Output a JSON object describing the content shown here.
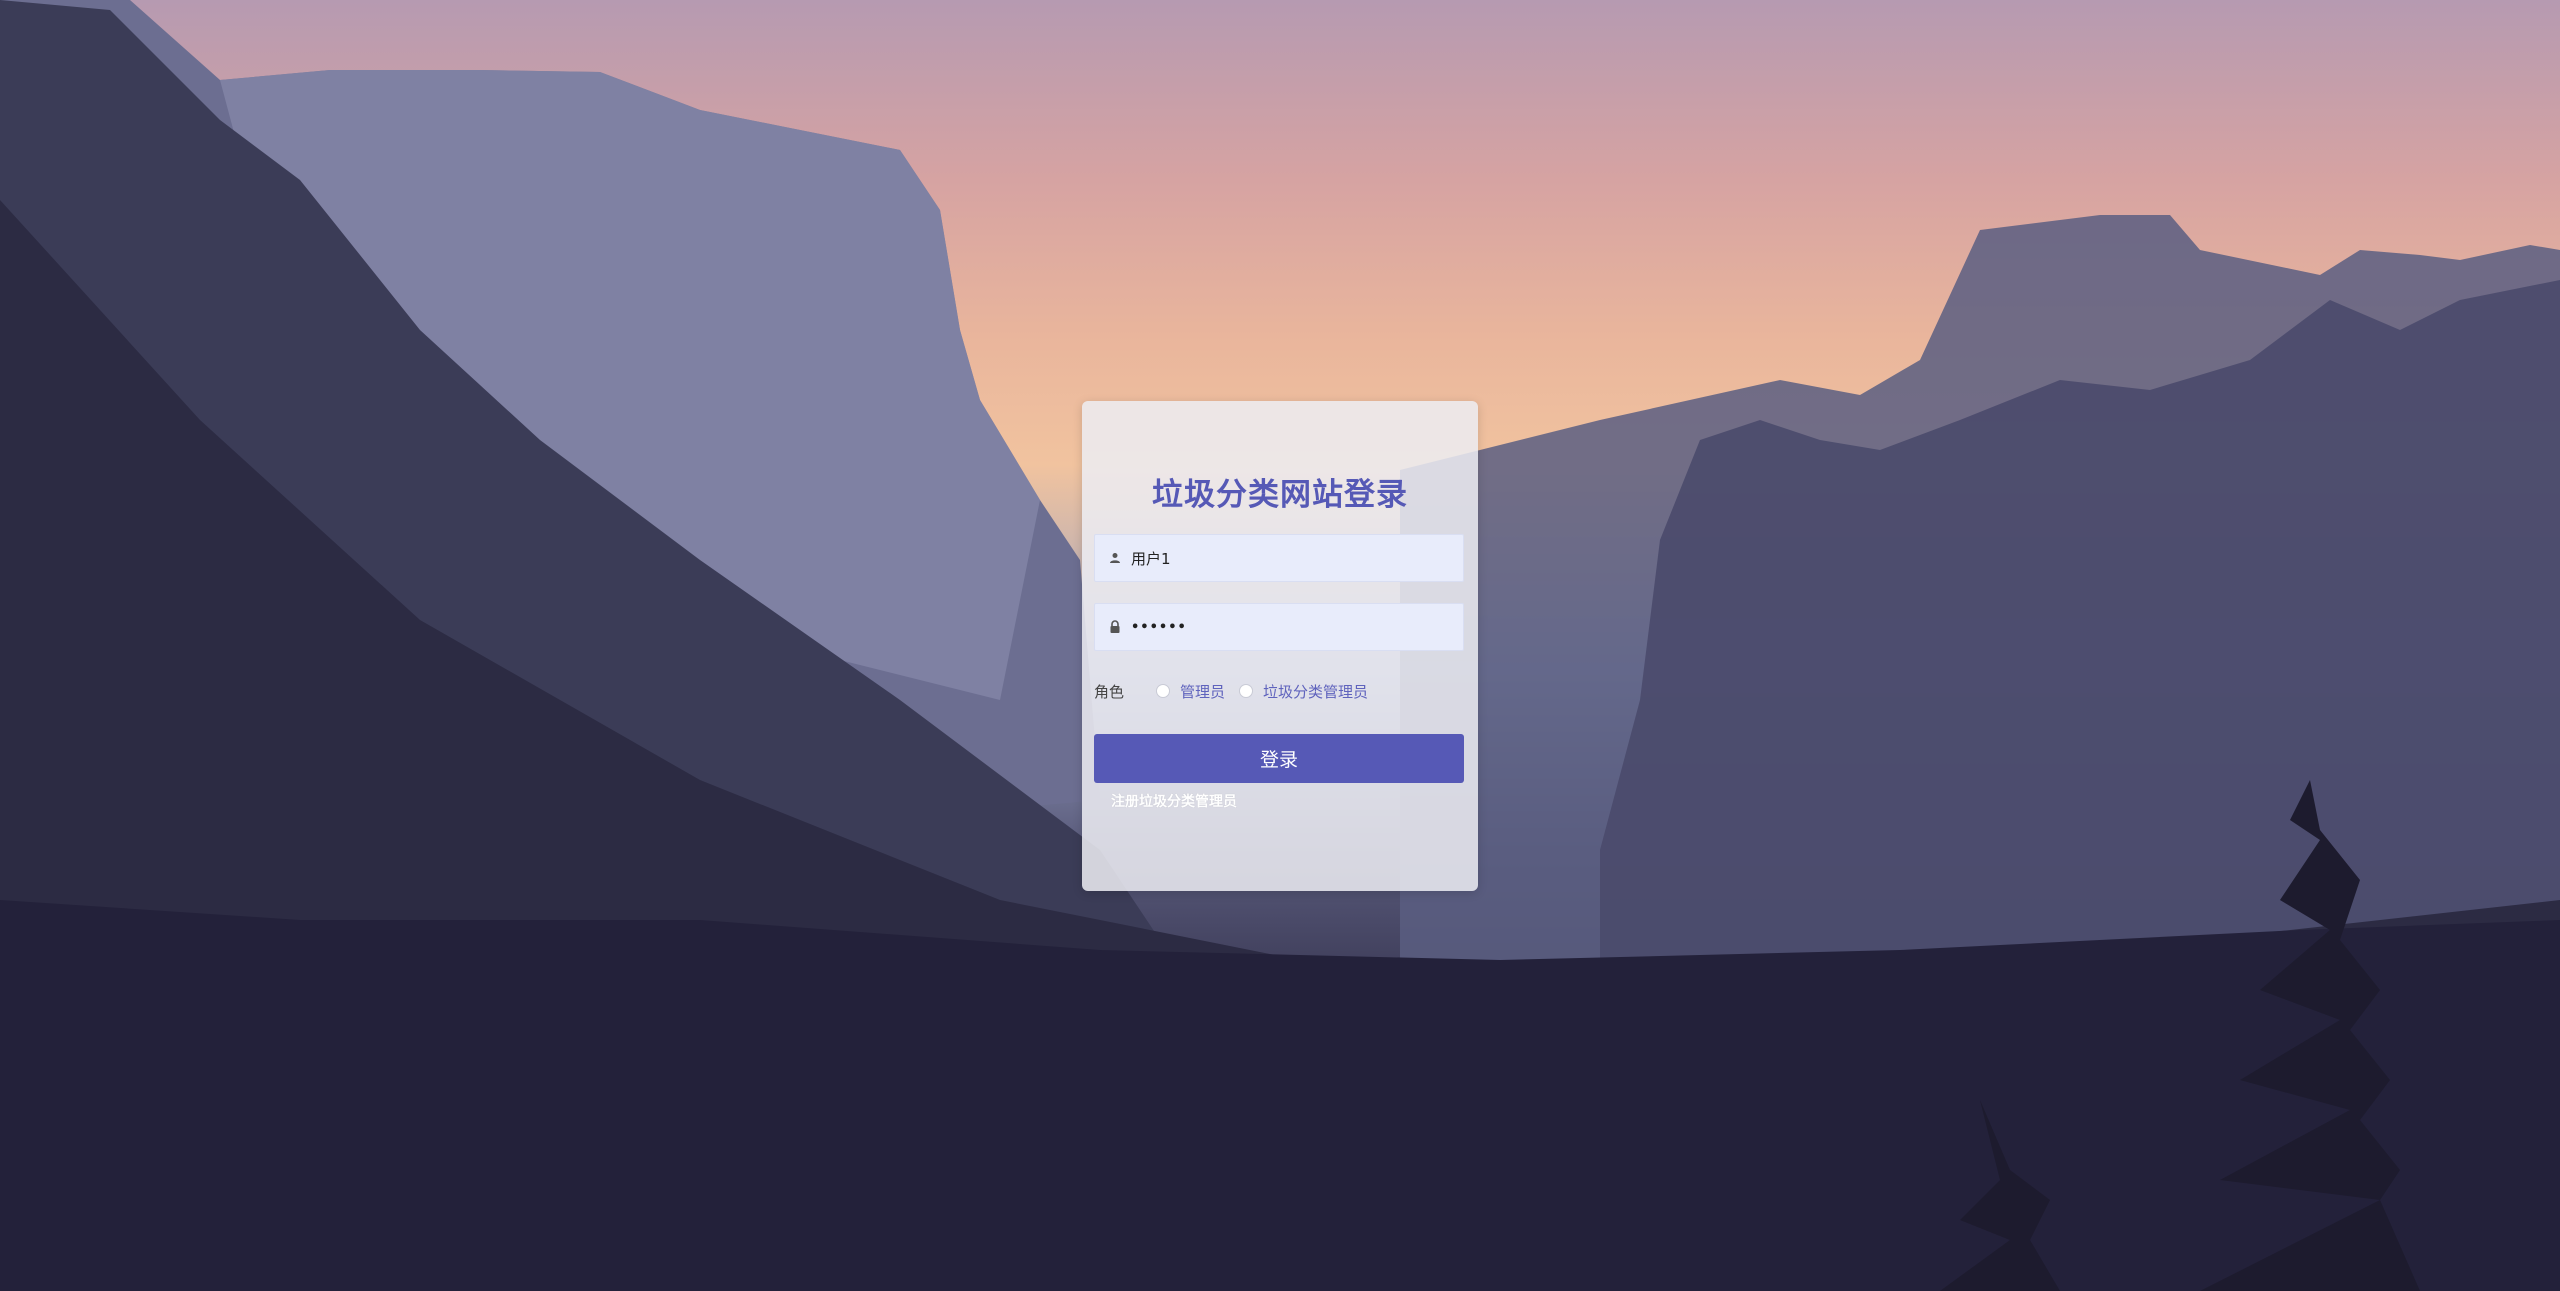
{
  "login_form": {
    "title": "垃圾分类网站登录",
    "username_value": "用户1",
    "password_value": "••••••",
    "role_label": "角色",
    "role_options": [
      "管理员",
      "垃圾分类管理员"
    ],
    "login_button": "登录",
    "register_link": "注册垃圾分类管理员"
  },
  "icons": {
    "username": "user-icon",
    "password": "lock-icon"
  },
  "colors": {
    "accent": "#5659b6",
    "field_bg": "#e8ecfb",
    "card_bg": "#ececf2"
  }
}
